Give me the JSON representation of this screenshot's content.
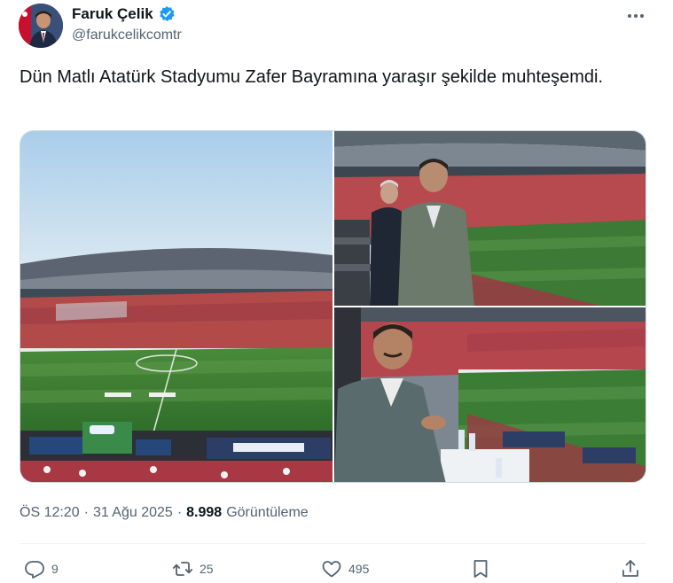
{
  "author": {
    "display_name": "Faruk Çelik",
    "handle": "@farukcelikcomtr",
    "verified": true,
    "avatar": "profile-photo"
  },
  "tweet": {
    "text": "Dün Matlı Atatürk Stadyumu Zafer Bayramına yaraşır şekilde muhteşemdi."
  },
  "media": [
    {
      "icon": "stadium-wide-view-photo"
    },
    {
      "icon": "man-in-stands-photo"
    },
    {
      "icon": "man-in-vip-box-photo"
    }
  ],
  "meta": {
    "time": "ÖS 12:20",
    "separator": "·",
    "date": "31 Ağu 2025",
    "views_count": "8.998",
    "views_label": "Görüntüleme"
  },
  "actions": {
    "replies": "9",
    "reposts": "25",
    "likes": "495"
  },
  "colors": {
    "text": "#0f1419",
    "secondary": "#536471",
    "verified_blue": "#1d9bf0",
    "border": "#cfd9de",
    "divider": "#eff3f4"
  }
}
